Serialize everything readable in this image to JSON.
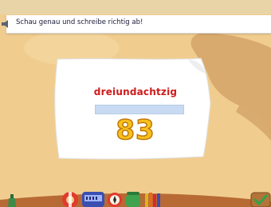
{
  "instruction": {
    "text": "Schau genau und schreibe richtig ab!",
    "speaker_icon": "speaker-icon"
  },
  "task": {
    "word": "dreiundachtzig",
    "number": "83",
    "answer_value": ""
  },
  "colors": {
    "background": "#f0cd8f",
    "island": "#d9aa6e",
    "word": "#d01a1a",
    "number_fill": "#f7c21b",
    "number_outline": "#c2770a",
    "input": "#c9dbf3"
  },
  "toolbar": {
    "icons": [
      "bottle-icon",
      "lifebuoy-icon",
      "calculator-icon",
      "compass-icon",
      "jar-icon",
      "crayons-icon",
      "checkmark-icon"
    ]
  }
}
